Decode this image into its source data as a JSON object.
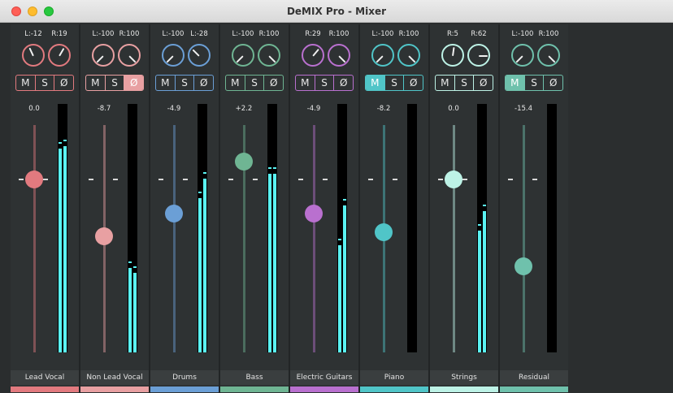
{
  "window": {
    "title": "DeMIX Pro - Mixer"
  },
  "buttons": {
    "mute": "M",
    "solo": "S",
    "phase": "Ø"
  },
  "channels": [
    {
      "name": "Lead Vocal",
      "color": "#e27a7f",
      "pan_l": "L:-12",
      "pan_r": "R:19",
      "db": "0.0",
      "muted": false,
      "solo": false,
      "phase": false,
      "fader": 0.24,
      "meters": [
        0.82,
        0.83
      ],
      "pan_l_angle": -25,
      "pan_r_angle": 30
    },
    {
      "name": "Non Lead Vocal",
      "color": "#e8a0a2",
      "pan_l": "L:-100",
      "pan_r": "R:100",
      "db": "-8.7",
      "muted": false,
      "solo": false,
      "phase": true,
      "fader": 0.49,
      "meters": [
        0.34,
        0.32
      ],
      "pan_l_angle": -135,
      "pan_r_angle": 135
    },
    {
      "name": "Drums",
      "color": "#6b9fd6",
      "pan_l": "L:-100",
      "pan_r": "L:-28",
      "db": "-4.9",
      "muted": false,
      "solo": false,
      "phase": false,
      "fader": 0.39,
      "meters": [
        0.62,
        0.7
      ],
      "pan_l_angle": -135,
      "pan_r_angle": -45
    },
    {
      "name": "Bass",
      "color": "#6fb593",
      "pan_l": "L:-100",
      "pan_r": "R:100",
      "db": "+2.2",
      "muted": false,
      "solo": false,
      "phase": false,
      "fader": 0.16,
      "meters": [
        0.72,
        0.72
      ],
      "pan_l_angle": -135,
      "pan_r_angle": 135
    },
    {
      "name": "Electric Guitars",
      "color": "#b970cf",
      "pan_l": "R:29",
      "pan_r": "R:100",
      "db": "-4.9",
      "muted": false,
      "solo": false,
      "phase": false,
      "fader": 0.39,
      "meters": [
        0.43,
        0.59
      ],
      "pan_l_angle": 40,
      "pan_r_angle": 135
    },
    {
      "name": "Piano",
      "color": "#50c5c8",
      "pan_l": "L:-100",
      "pan_r": "R:100",
      "db": "-8.2",
      "muted": true,
      "solo": false,
      "phase": false,
      "fader": 0.47,
      "meters": [
        0.0,
        0.0
      ],
      "pan_l_angle": -135,
      "pan_r_angle": 135
    },
    {
      "name": "Strings",
      "color": "#bdf2e6",
      "pan_l": "R:5",
      "pan_r": "R:62",
      "db": "0.0",
      "muted": false,
      "solo": false,
      "phase": false,
      "fader": 0.24,
      "meters": [
        0.49,
        0.57
      ],
      "pan_l_angle": 8,
      "pan_r_angle": 90
    },
    {
      "name": "Residual",
      "color": "#6fc1ac",
      "pan_l": "L:-100",
      "pan_r": "R:100",
      "db": "-15.4",
      "muted": true,
      "solo": false,
      "phase": false,
      "fader": 0.62,
      "meters": [
        0.0,
        0.0
      ],
      "pan_l_angle": -135,
      "pan_r_angle": 135
    }
  ]
}
